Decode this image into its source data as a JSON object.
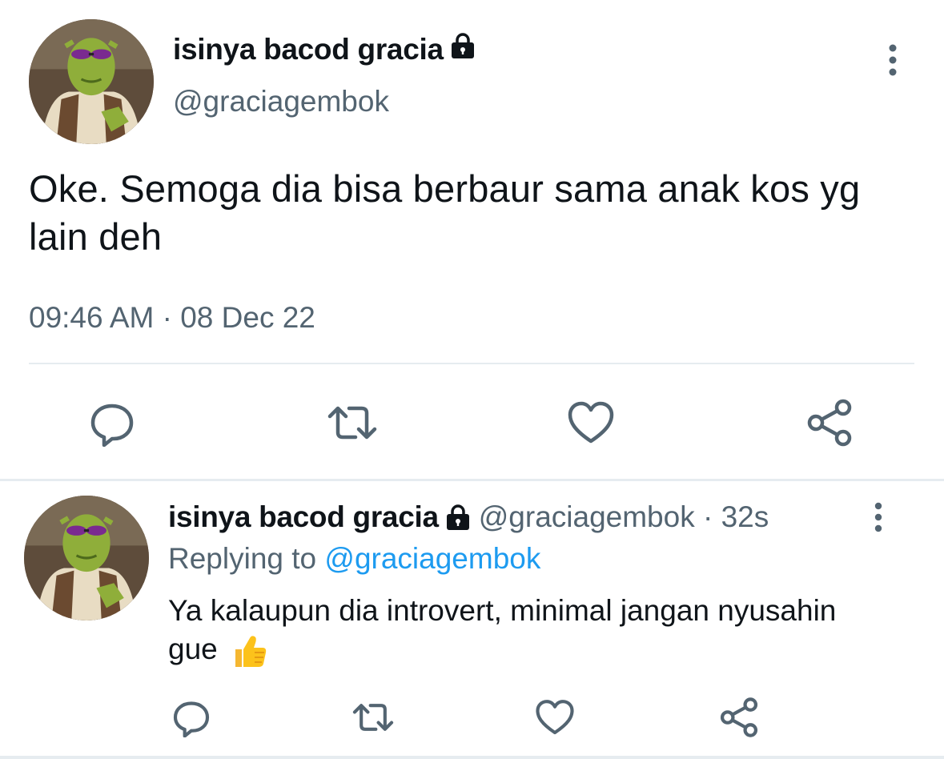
{
  "main_tweet": {
    "display_name": "isinya bacod gracia",
    "handle": "@graciagembok",
    "text": "Oke. Semoga dia bisa berbaur sama anak kos yg lain deh",
    "timestamp": "09:46 AM · 08 Dec 22",
    "icons": {
      "protected": "lock-icon",
      "more": "more-vertical-icon",
      "actions": [
        "reply-icon",
        "retweet-icon",
        "like-icon",
        "share-icon"
      ]
    }
  },
  "reply_tweet": {
    "display_name": "isinya bacod gracia",
    "handle": "@graciagembok",
    "separator": " · ",
    "age": "32s",
    "replying_prefix": "Replying to ",
    "replying_to": "@graciagembok",
    "text": "Ya kalaupun dia introvert, minimal jangan nyusahin gue",
    "emoji": "👍",
    "icons": {
      "protected": "lock-icon",
      "more": "more-vertical-icon",
      "actions": [
        "reply-icon",
        "retweet-icon",
        "like-icon",
        "share-icon"
      ]
    }
  },
  "colors": {
    "text_primary": "#0f1419",
    "text_secondary": "#536471",
    "link": "#1d9bf0",
    "divider": "#e6ecf0",
    "icon": "#536471"
  }
}
